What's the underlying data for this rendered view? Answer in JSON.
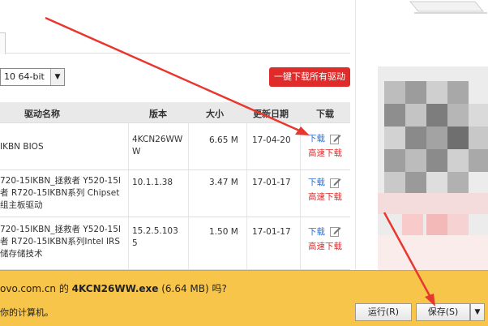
{
  "os_select": {
    "value": "10 64-bit"
  },
  "download_all_label": "一键下载所有驱动",
  "table": {
    "headers": {
      "name": "驱动名称",
      "version": "版本",
      "size": "大小",
      "date": "更新日期",
      "download": "下载"
    },
    "rows": [
      {
        "name": [
          "IKBN BIOS"
        ],
        "version": [
          "4KCN26WW",
          "W"
        ],
        "size": "6.65 M",
        "date": "17-04-20",
        "download": "下载",
        "fast": "高速下载"
      },
      {
        "name": [
          "720-15IKBN_拯救者 Y520-15I",
          "者 R720-15IKBN系列 Chipset",
          "组主板驱动"
        ],
        "version": [
          "10.1.1.38"
        ],
        "size": "3.47 M",
        "date": "17-01-17",
        "download": "下载",
        "fast": "高速下载"
      },
      {
        "name": [
          "720-15IKBN_拯救者 Y520-15I",
          "者 R720-15IKBN系列Intel IRS",
          "储存储技术"
        ],
        "version": [
          "15.2.5.103",
          "5"
        ],
        "size": "1.50 M",
        "date": "17-01-17",
        "download": "下载",
        "fast": "高速下载"
      }
    ]
  },
  "download_bar": {
    "domain_prefix": "ovo.com.cn 的 ",
    "filename": "4KCN26WW.exe",
    "size_text": " (6.64 MB) 吗?",
    "subtext": "你的计算机。",
    "run_label": "运行(R)",
    "save_label": "保存(S)",
    "dropdown_glyph": "▼"
  },
  "colors": {
    "accent_red": "#e02b2b",
    "link_blue": "#2c6fd6",
    "bar_yellow": "#f7c54a"
  },
  "icons": {
    "edit": "pencil-icon",
    "select": "chevron-down-icon",
    "annotation": "red-arrow"
  }
}
